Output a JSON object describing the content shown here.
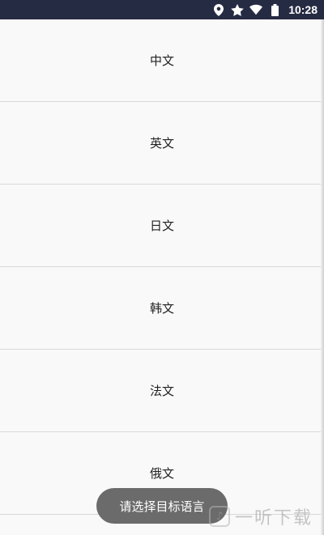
{
  "status_bar": {
    "time": "10:28",
    "icons": [
      "location-icon",
      "star-icon",
      "wifi-icon",
      "battery-icon"
    ],
    "background": "#262b44"
  },
  "languages": [
    {
      "label": "中文"
    },
    {
      "label": "英文"
    },
    {
      "label": "日文"
    },
    {
      "label": "韩文"
    },
    {
      "label": "法文"
    },
    {
      "label": "俄文"
    }
  ],
  "toast": {
    "text": "请选择目标语言"
  },
  "watermark": {
    "text": "一听下载"
  }
}
